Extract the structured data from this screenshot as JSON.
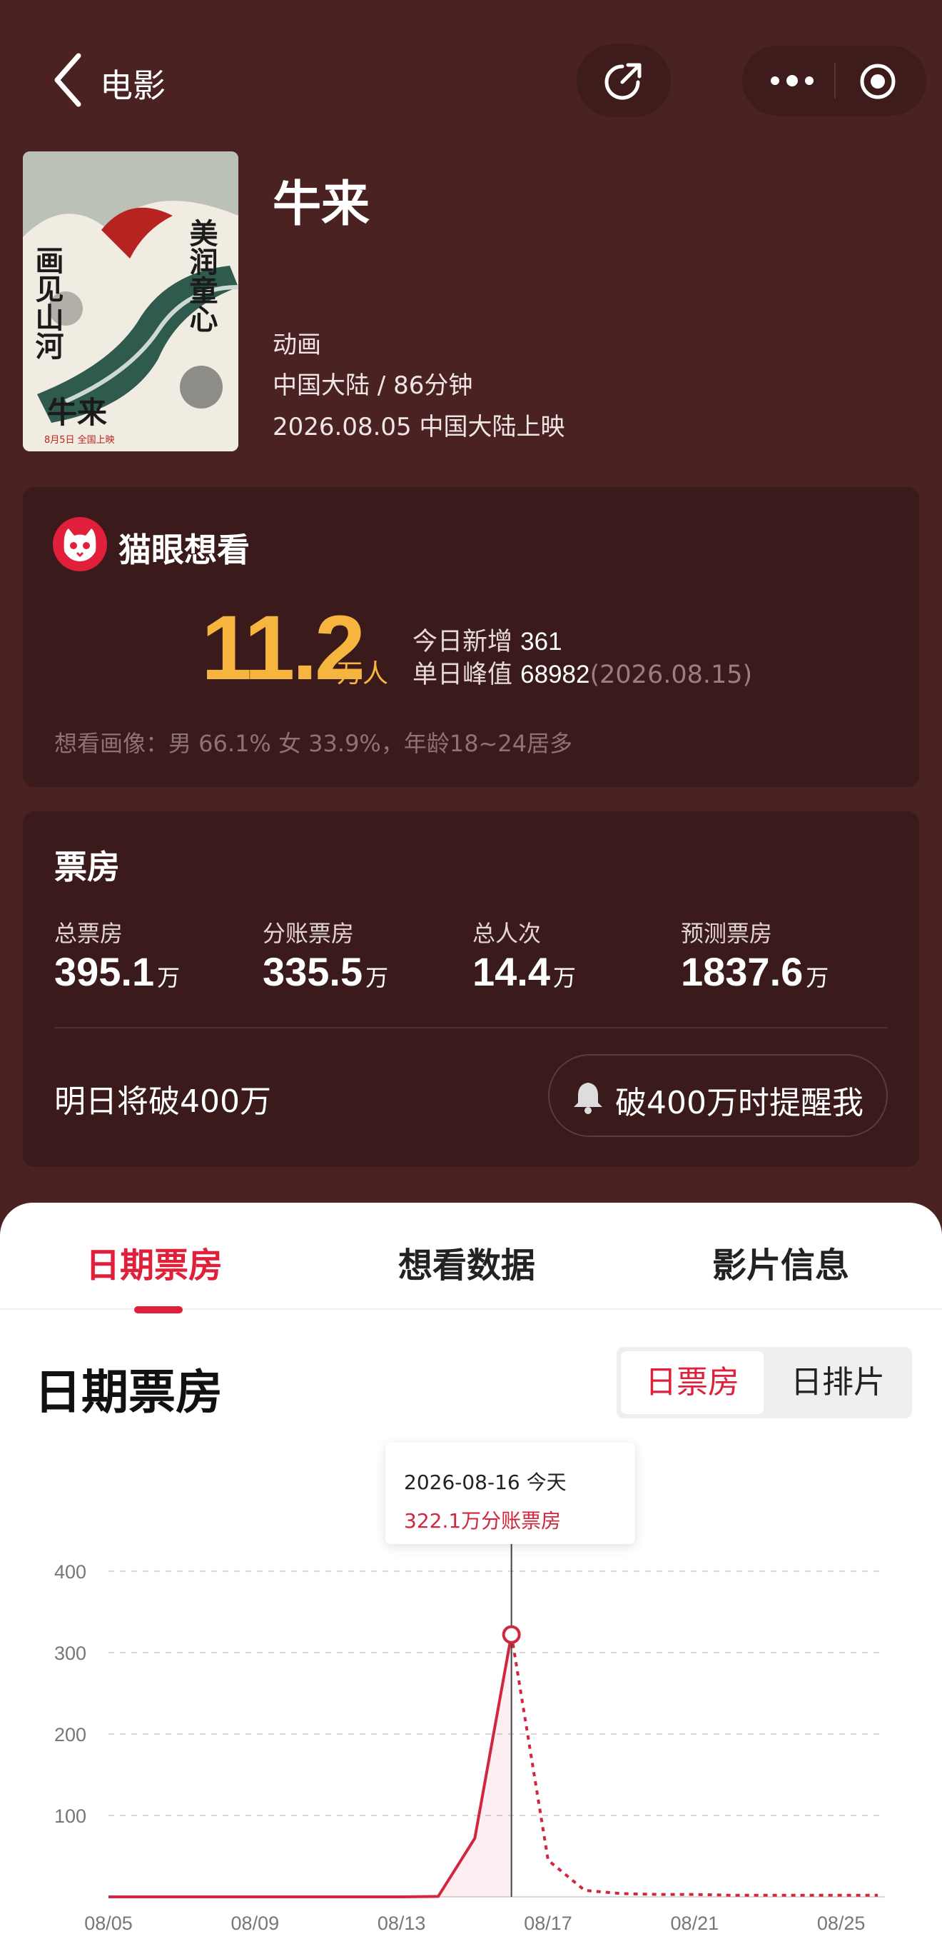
{
  "header": {
    "title": "电影",
    "back_icon": "chevron-left-icon",
    "share_icon": "share-icon",
    "more_icon": "more-dots-icon",
    "target_icon": "target-icon"
  },
  "movie": {
    "title": "牛来",
    "genre": "动画",
    "region_duration": "中国大陆 / 86分钟",
    "release": "2026.08.05 中国大陆上映",
    "poster_text": [
      "画见山河",
      "美润童心",
      "牛来",
      "8月5日 全国上映"
    ]
  },
  "want": {
    "brand": "猫眼想看",
    "count": "11.2",
    "unit": "万人",
    "today_label": "今日新增",
    "today_value": "361",
    "peak_label": "单日峰值",
    "peak_value": "68982",
    "peak_date": "(2026.08.15)",
    "portrait": "想看画像：男 66.1% 女 33.9%，年龄18~24居多"
  },
  "box_office": {
    "title": "票房",
    "stats": [
      {
        "label": "总票房",
        "value": "395.1",
        "unit": "万"
      },
      {
        "label": "分账票房",
        "value": "335.5",
        "unit": "万"
      },
      {
        "label": "总人次",
        "value": "14.4",
        "unit": "万"
      },
      {
        "label": "预测票房",
        "value": "1837.6",
        "unit": "万"
      }
    ],
    "tomorrow": "明日将破400万",
    "remind_label": "破400万时提醒我",
    "remind_icon": "bell-icon"
  },
  "tabs": [
    {
      "label": "日期票房",
      "active": true
    },
    {
      "label": "想看数据",
      "active": false
    },
    {
      "label": "影片信息",
      "active": false
    }
  ],
  "section": {
    "title": "日期票房",
    "toggle": [
      "日票房",
      "日排片"
    ]
  },
  "tooltip": {
    "date": "2026-08-16 今天",
    "value": "322.1万分账票房"
  },
  "colors": {
    "accent": "#e0203a",
    "gold": "#f6b53e",
    "background": "#4a2222",
    "card": "#3a1a1a"
  },
  "chart_data": {
    "type": "line",
    "x_ticks": [
      "08/05",
      "08/09",
      "08/13",
      "08/17",
      "08/21",
      "08/25"
    ],
    "y_ticks": [
      100,
      200,
      300,
      400
    ],
    "ylim": [
      0,
      400
    ],
    "xlim": [
      "08/05",
      "08/26"
    ],
    "grid": true,
    "series": [
      {
        "style": "solid",
        "x": [
          "08/05",
          "08/06",
          "08/07",
          "08/08",
          "08/09",
          "08/10",
          "08/11",
          "08/12",
          "08/13",
          "08/14",
          "08/15",
          "08/16"
        ],
        "values": [
          0,
          0,
          0,
          0,
          0,
          0,
          0,
          0,
          0,
          0.5,
          72,
          322.1
        ]
      },
      {
        "style": "dotted",
        "x": [
          "08/16",
          "08/17",
          "08/18",
          "08/19",
          "08/20",
          "08/21",
          "08/22",
          "08/23",
          "08/24",
          "08/25",
          "08/26"
        ],
        "values": [
          322.1,
          45,
          8,
          4,
          3,
          3,
          2,
          2,
          2,
          2,
          2
        ]
      }
    ],
    "highlight": {
      "x": "08/16",
      "value": 322.1
    }
  }
}
